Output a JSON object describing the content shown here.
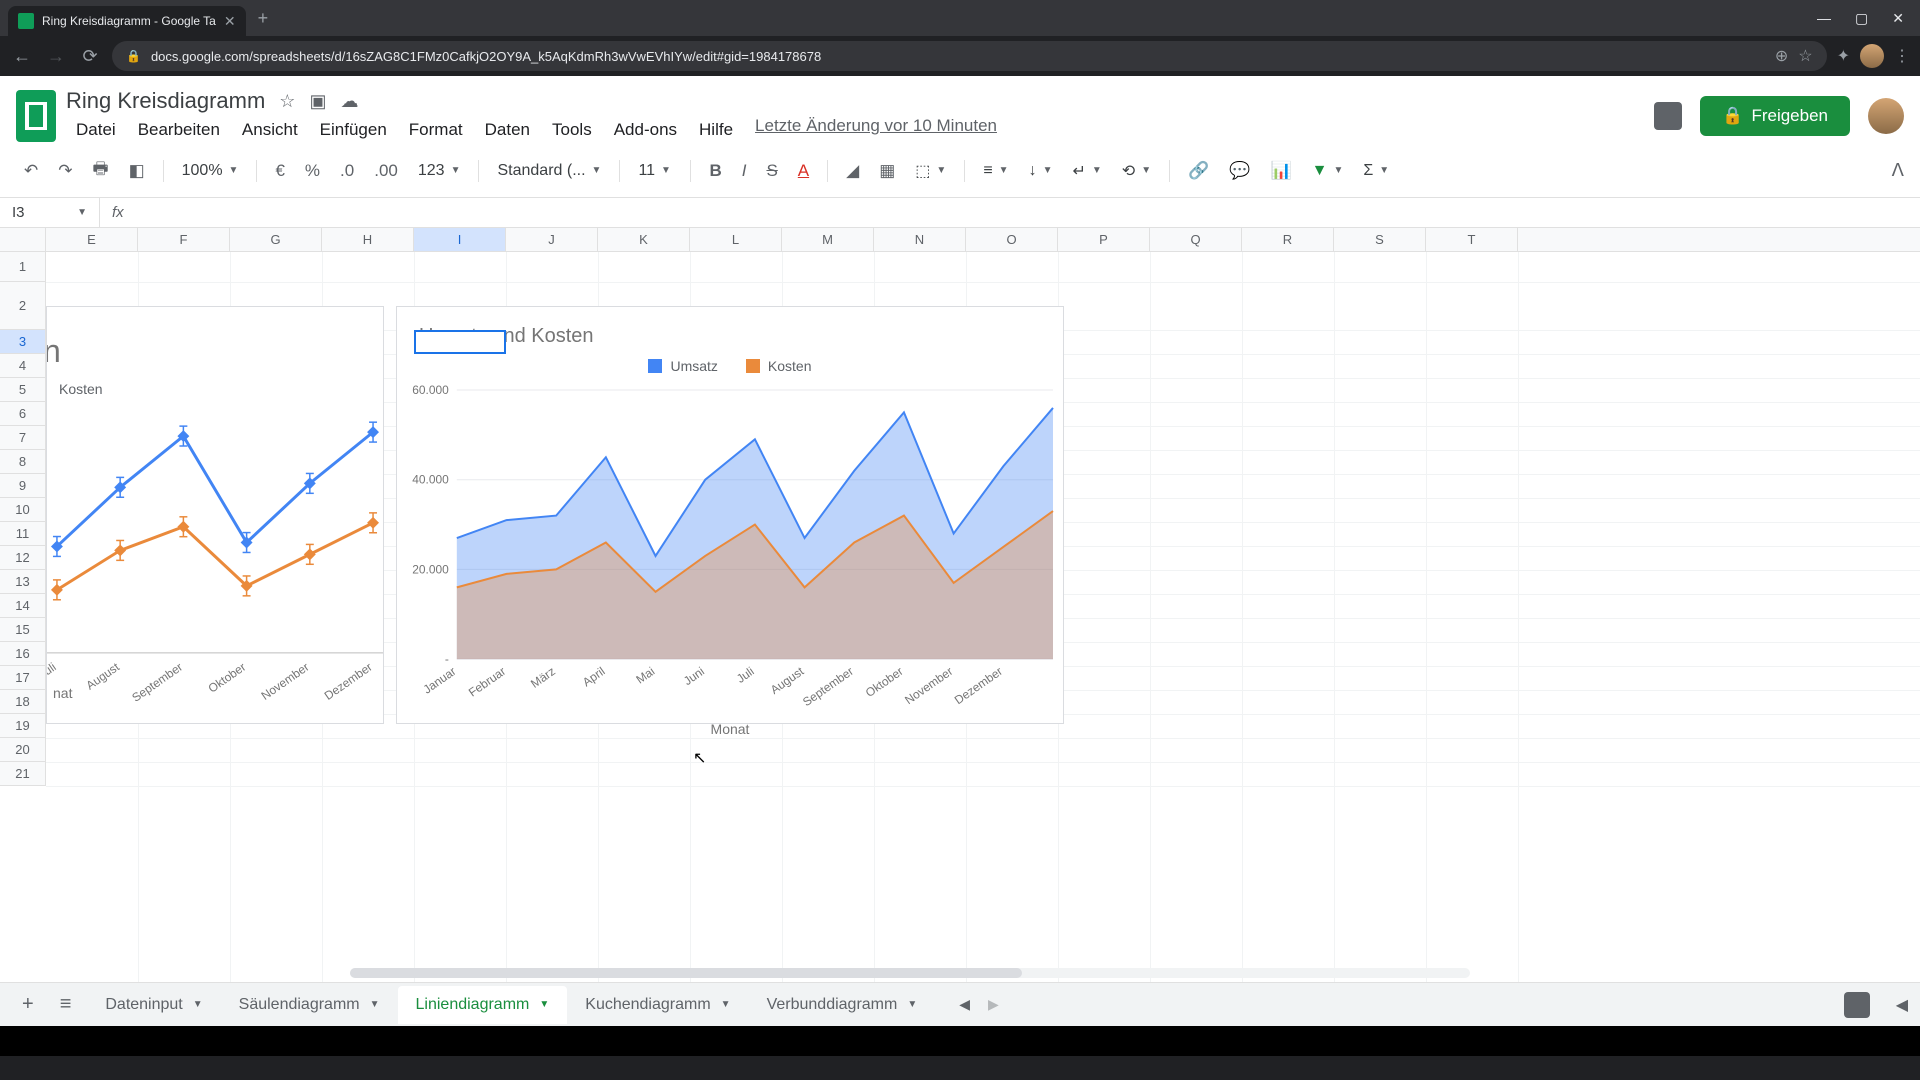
{
  "browser": {
    "tab_title": "Ring Kreisdiagramm - Google Ta",
    "url": "docs.google.com/spreadsheets/d/16sZAG8C1FMz0CafkjO2OY9A_k5AqKdmRh3wVwEVhIYw/edit#gid=1984178678"
  },
  "app": {
    "doc_title": "Ring Kreisdiagramm",
    "menus": [
      "Datei",
      "Bearbeiten",
      "Ansicht",
      "Einfügen",
      "Format",
      "Daten",
      "Tools",
      "Add-ons",
      "Hilfe"
    ],
    "last_edit": "Letzte Änderung vor 10 Minuten",
    "share_label": "Freigeben",
    "toolbar": {
      "zoom": "100%",
      "currency": "€",
      "percent": "%",
      "dec_dec": ".0",
      "inc_dec": ".00",
      "num_format": "123",
      "font": "Standard (...",
      "font_size": "11"
    },
    "cell_ref": "I3",
    "columns": [
      "E",
      "F",
      "G",
      "H",
      "I",
      "J",
      "K",
      "L",
      "M",
      "N",
      "O",
      "P",
      "Q",
      "R",
      "S",
      "T"
    ],
    "rows": [
      1,
      2,
      3,
      4,
      5,
      6,
      7,
      8,
      9,
      10,
      11,
      12,
      13,
      14,
      15,
      16,
      17,
      18,
      19,
      20,
      21
    ],
    "sheet_tabs": [
      "Dateninput",
      "Säulendiagramm",
      "Liniendiagramm",
      "Kuchendiagramm",
      "Verbunddiagramm"
    ],
    "active_sheet": "Liniendiagramm"
  },
  "chart1_partial": {
    "title_fragment": "n",
    "legend_visible": "Kosten",
    "xlabel": "nat",
    "x_visible": [
      "Juli",
      "August",
      "September",
      "Oktober",
      "November",
      "Dezember"
    ]
  },
  "chart_data": {
    "type": "area",
    "stacked": false,
    "title": "Umsatz und Kosten",
    "xlabel": "Monat",
    "ylabel": "",
    "ylim": [
      0,
      60000
    ],
    "y_ticks": [
      0,
      20000,
      40000,
      60000
    ],
    "y_tick_labels": [
      "-",
      "20.000",
      "40.000",
      "60.000"
    ],
    "categories": [
      "Januar",
      "Februar",
      "März",
      "April",
      "Mai",
      "Juni",
      "Juli",
      "August",
      "September",
      "Oktober",
      "November",
      "Dezember"
    ],
    "series": [
      {
        "name": "Umsatz",
        "color": "#4285f4",
        "values": [
          27000,
          31000,
          32000,
          45000,
          23000,
          40000,
          49000,
          27000,
          42000,
          55000,
          28000,
          43000,
          56000
        ]
      },
      {
        "name": "Kosten",
        "color": "#ea8a3b",
        "values": [
          16000,
          19000,
          20000,
          26000,
          15000,
          23000,
          30000,
          16000,
          26000,
          32000,
          17000,
          25000,
          33000
        ]
      }
    ],
    "legend_position": "top"
  },
  "chart1_data": {
    "type": "line",
    "markers": true,
    "error_bars": true,
    "title": "Umsatz und Kosten",
    "xlabel": "Monat",
    "categories": [
      "Juli",
      "August",
      "September",
      "Oktober",
      "November",
      "Dezember"
    ],
    "series": [
      {
        "name": "Umsatz",
        "color": "#4285f4",
        "values": [
          27000,
          42000,
          55000,
          28000,
          43000,
          56000
        ]
      },
      {
        "name": "Kosten",
        "color": "#ea8a3b",
        "values": [
          16000,
          26000,
          32000,
          17000,
          25000,
          33000
        ]
      }
    ],
    "ylim": [
      0,
      60000
    ]
  }
}
